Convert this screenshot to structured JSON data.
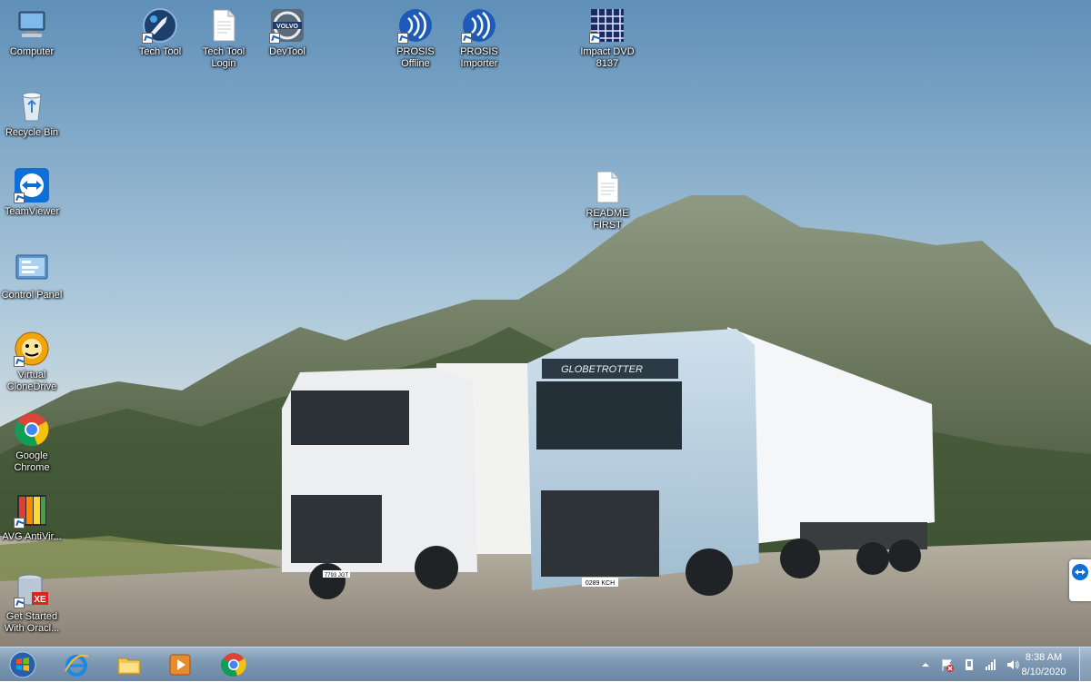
{
  "desktop_icons": [
    {
      "id": "computer",
      "label": "Computer",
      "icon": "computer-icon"
    },
    {
      "id": "recycle-bin",
      "label": "Recycle Bin",
      "icon": "recycle-bin-icon"
    },
    {
      "id": "teamviewer",
      "label": "TeamViewer",
      "icon": "teamviewer-icon"
    },
    {
      "id": "control-panel",
      "label": "Control Panel",
      "icon": "control-panel-icon"
    },
    {
      "id": "virtual-clonedrive",
      "label": "Virtual CloneDrive",
      "icon": "virtual-clonedrive-icon"
    },
    {
      "id": "google-chrome",
      "label": "Google Chrome",
      "icon": "chrome-icon"
    },
    {
      "id": "avg-antivirus",
      "label": "AVG AntiVir...",
      "icon": "avg-icon"
    },
    {
      "id": "get-started-oracle",
      "label": "Get Started With Oracl...",
      "icon": "oracle-db-icon"
    },
    {
      "id": "tech-tool",
      "label": "Tech Tool",
      "icon": "tech-tool-icon"
    },
    {
      "id": "tech-tool-login",
      "label": "Tech Tool Login",
      "icon": "document-icon"
    },
    {
      "id": "devtool",
      "label": "DevTool",
      "icon": "volvo-icon"
    },
    {
      "id": "prosis-offline",
      "label": "PROSIS Offline",
      "icon": "prosis-icon"
    },
    {
      "id": "prosis-importer",
      "label": "PROSIS Importer",
      "icon": "prosis-icon"
    },
    {
      "id": "impact-dvd",
      "label": "Impact DVD 8137",
      "icon": "impact-icon"
    },
    {
      "id": "readme-first",
      "label": "README FIRST",
      "icon": "document-icon"
    }
  ],
  "wallpaper": {
    "trucks": [
      {
        "plate": "7793 JGT"
      },
      {
        "plate": "0289 KCH"
      }
    ],
    "cab_text": "GLOBETROTTER"
  },
  "taskbar": {
    "pinned": [
      {
        "id": "start",
        "icon": "windows-start-icon"
      },
      {
        "id": "ie",
        "icon": "internet-explorer-icon"
      },
      {
        "id": "explorer",
        "icon": "file-explorer-icon"
      },
      {
        "id": "media",
        "icon": "media-player-icon"
      },
      {
        "id": "chrome",
        "icon": "chrome-icon"
      }
    ],
    "clock": {
      "time": "8:38 AM",
      "date": "8/10/2020"
    }
  }
}
